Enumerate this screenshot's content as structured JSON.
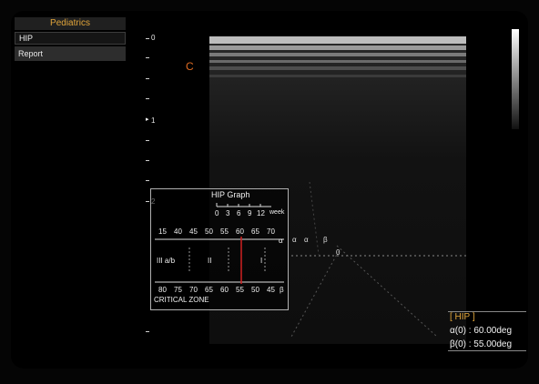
{
  "menu": {
    "header": "Pediatrics",
    "selected_item": "HIP",
    "report_label": "Report"
  },
  "depth_scale": {
    "labels": [
      "0",
      "1",
      "2"
    ]
  },
  "focus_label": "C",
  "hip_graph": {
    "title": "HIP Graph",
    "week_labels": [
      "0",
      "3",
      "6",
      "9",
      "12"
    ],
    "week_unit": "week",
    "alpha_scale": [
      "15",
      "40",
      "45",
      "50",
      "55",
      "60",
      "65",
      "70"
    ],
    "alpha_symbol": "α",
    "zones": [
      "III a/b",
      "II",
      "I"
    ],
    "beta_scale": [
      "80",
      "75",
      "70",
      "65",
      "60",
      "55",
      "50",
      "45"
    ],
    "beta_symbol": "β",
    "critical_zone": "CRITICAL ZONE"
  },
  "angle_overlay": {
    "alpha": "α",
    "alpha2": "α",
    "beta": "β",
    "origin": "0"
  },
  "readout": {
    "title": "[ HIP ]",
    "alpha_line": "α(0) : 60.00deg",
    "beta_line": "β(0) : 55.00deg"
  },
  "colors": {
    "menu_header_text": "#e0a43a",
    "focus_label": "#e06b22",
    "readout_title": "#e0a43a",
    "marker_line": "#d02020"
  }
}
